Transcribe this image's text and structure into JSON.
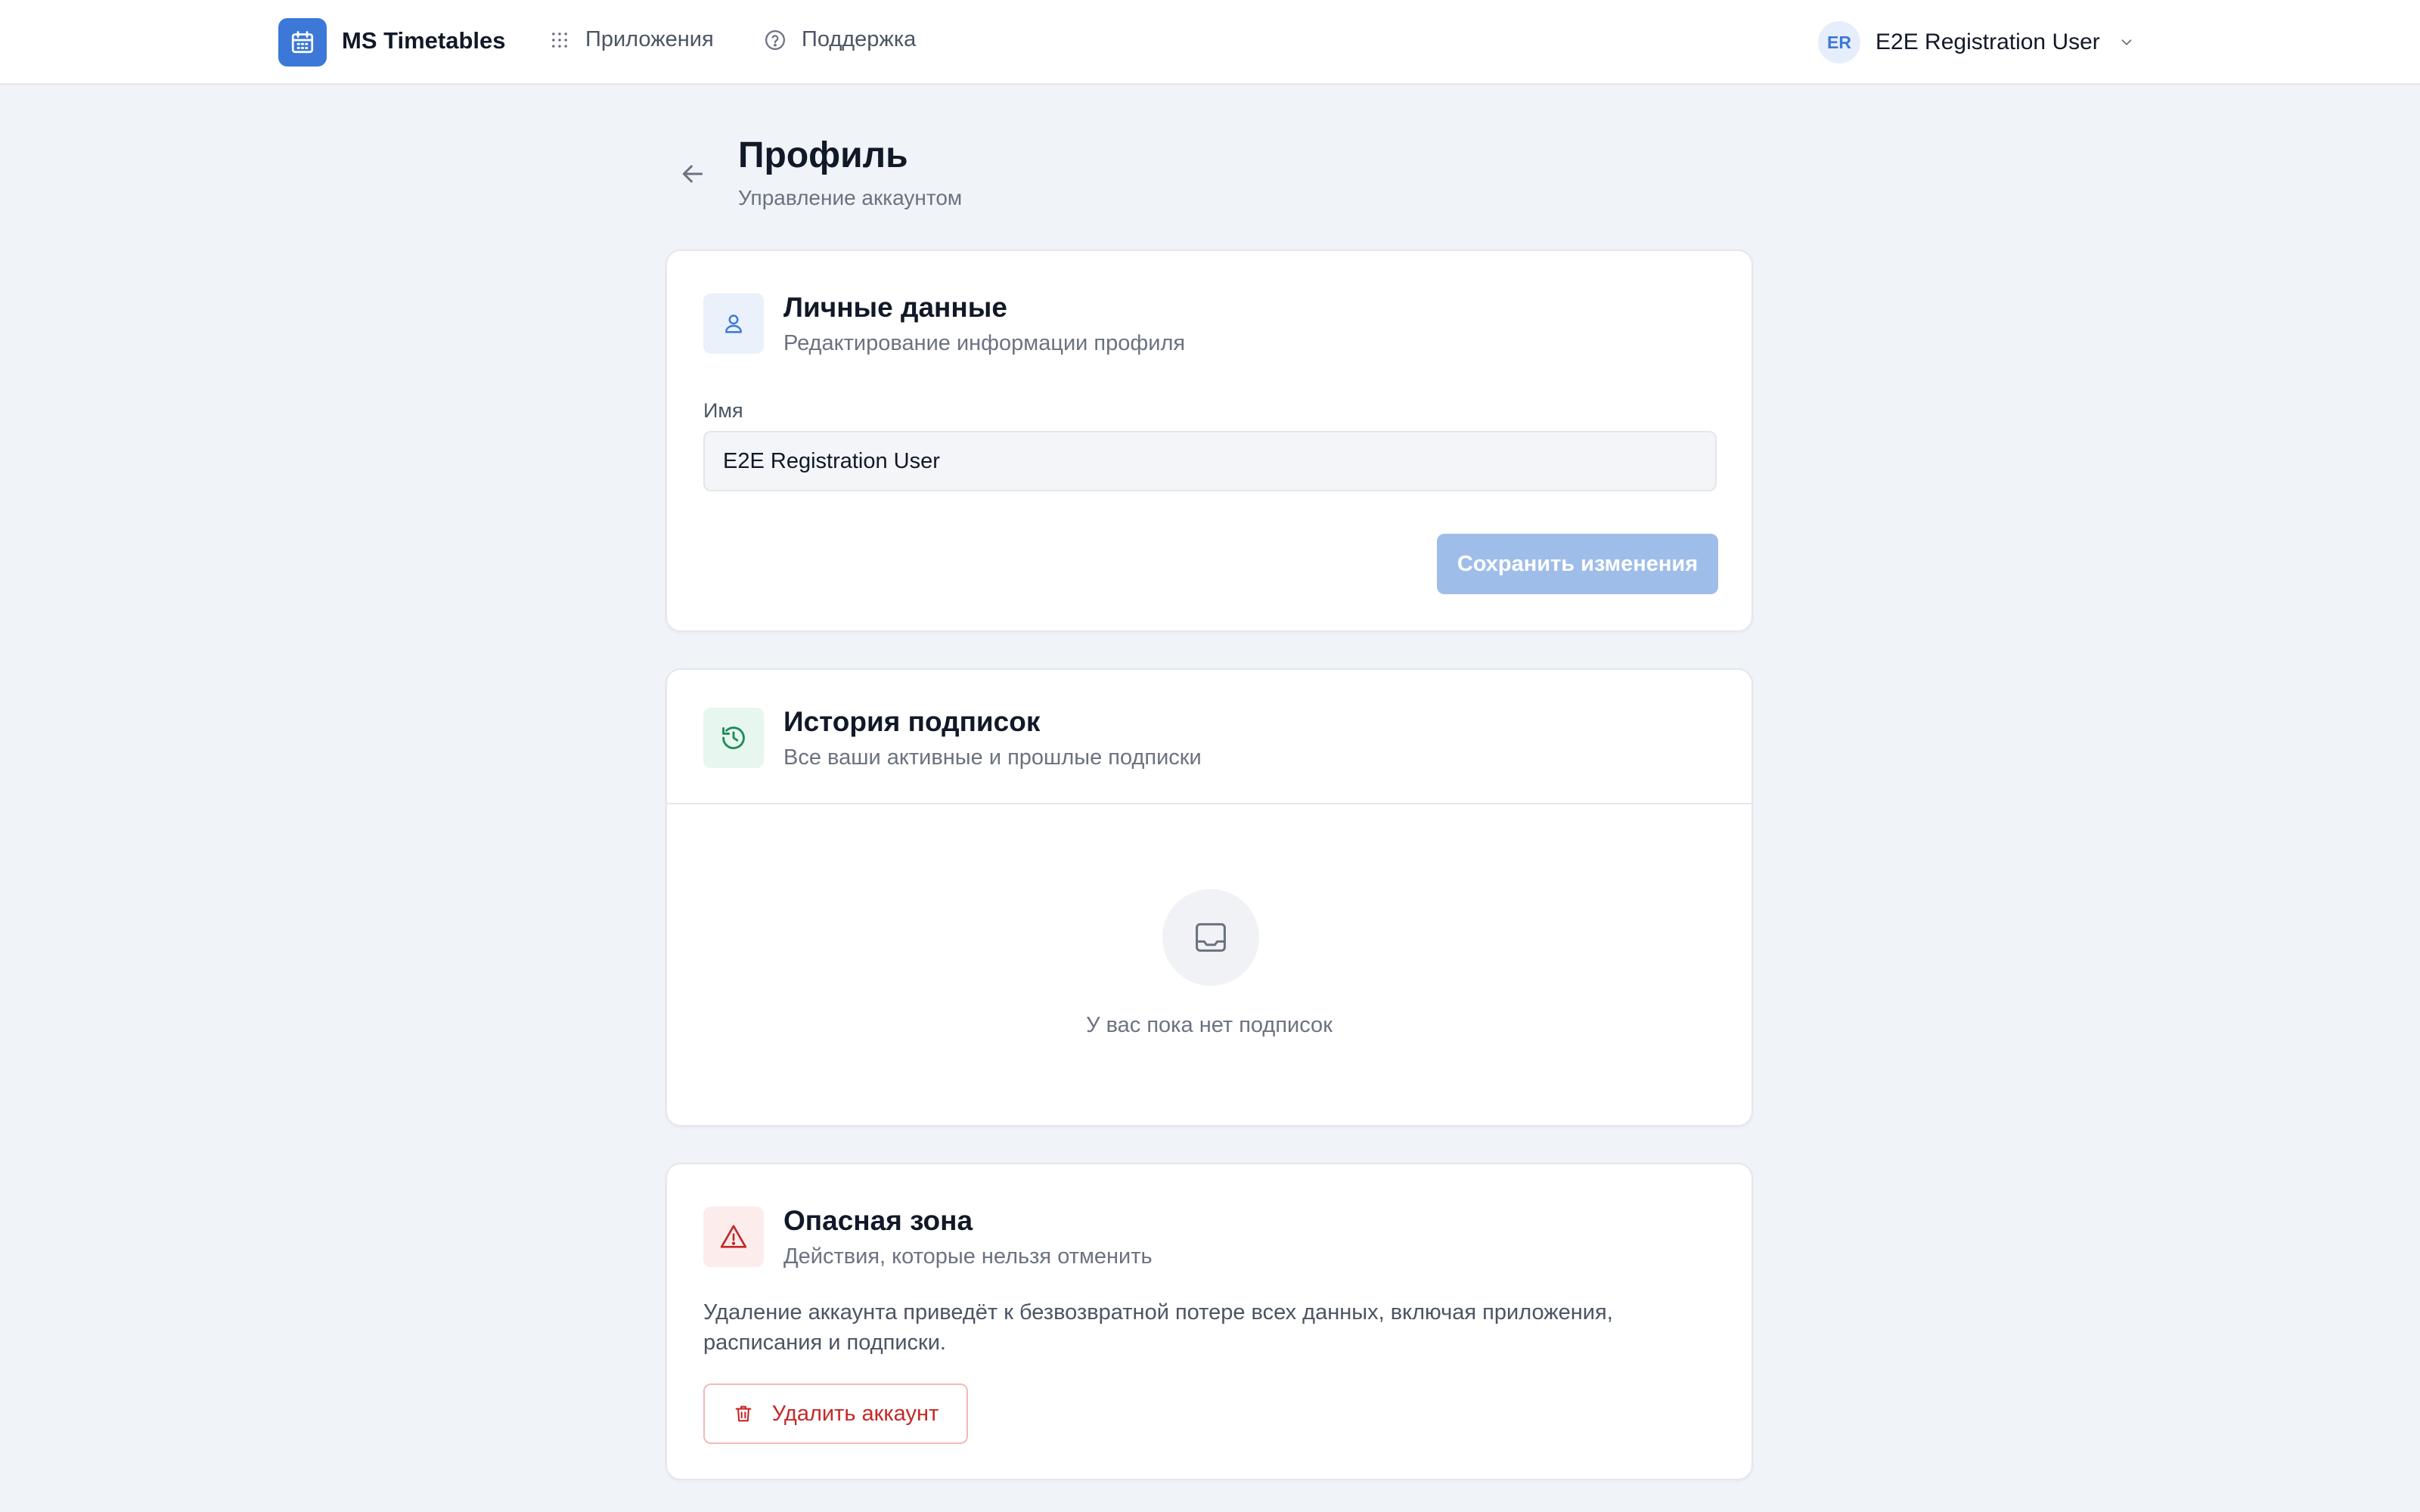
{
  "header": {
    "app_name": "MS Timetables",
    "logo_icon": "calendar-icon",
    "nav": [
      {
        "label": "Приложения",
        "icon": "grid-dots-icon"
      },
      {
        "label": "Поддержка",
        "icon": "help-circle-icon"
      }
    ],
    "user": {
      "initials": "ER",
      "name": "E2E Registration User",
      "icon": "chevron-down-icon"
    }
  },
  "page": {
    "title": "Профиль",
    "subtitle": "Управление аккаунтом",
    "back_icon": "arrow-left-icon"
  },
  "personal": {
    "icon": "user-icon",
    "title": "Личные данные",
    "description": "Редактирование информации профиля",
    "name_label": "Имя",
    "name_value": "E2E Registration User",
    "save_label": "Сохранить изменения"
  },
  "history": {
    "icon": "history-icon",
    "title": "История подписок",
    "description": "Все ваши активные и прошлые подписки",
    "empty_icon": "inbox-icon",
    "empty_text": "У вас пока нет подписок"
  },
  "danger": {
    "icon": "warning-icon",
    "title": "Опасная зона",
    "description": "Действия, которые нельзя отменить",
    "warning_text": "Удаление аккаунта приведёт к безвозвратной потере всех данных, включая приложения, расписания и подписки.",
    "delete_label": "Удалить аккаунт",
    "delete_icon": "trash-icon"
  },
  "colors": {
    "primary": "#3b78d8",
    "primary_disabled": "#9fbde9",
    "danger": "#c62828",
    "background": "#f0f3f8"
  }
}
